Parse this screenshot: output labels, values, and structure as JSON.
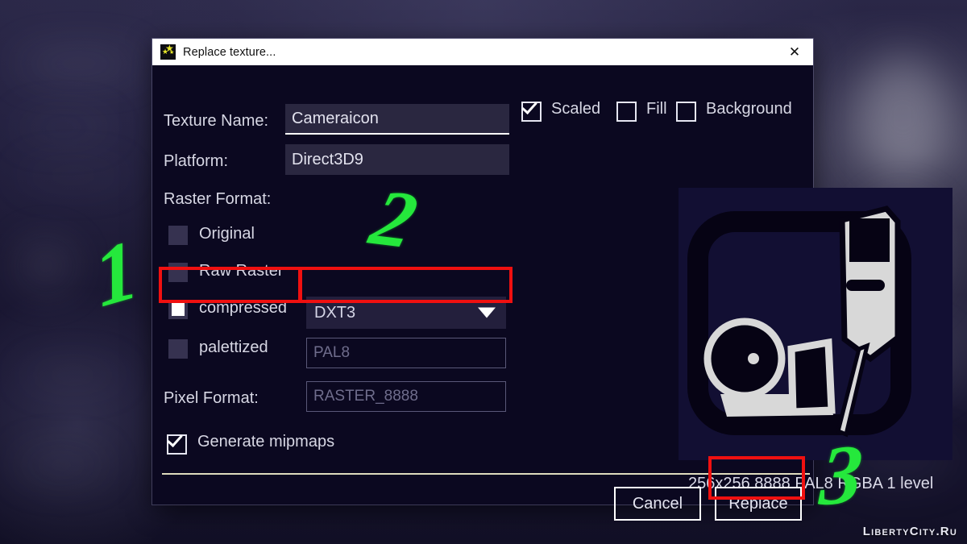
{
  "window": {
    "title": "Replace texture...",
    "icon": "stars-icon",
    "close_label": "✕"
  },
  "form": {
    "texture_name_label": "Texture Name:",
    "texture_name_value": "Cameraicon",
    "platform_label": "Platform:",
    "platform_value": "Direct3D9",
    "raster_format_label": "Raster Format:",
    "options": [
      {
        "label": "Original",
        "checked": false
      },
      {
        "label": "Raw Raster",
        "checked": false
      },
      {
        "label": "compressed",
        "checked": true
      },
      {
        "label": "palettized",
        "checked": false
      }
    ],
    "compression_value": "DXT3",
    "palette_value": "PAL8",
    "pixel_format_label": "Pixel Format:",
    "pixel_format_value": "RASTER_8888",
    "generate_mipmaps_label": "Generate mipmaps",
    "generate_mipmaps_checked": true
  },
  "preview": {
    "toggles": [
      {
        "label": "Scaled",
        "checked": true
      },
      {
        "label": "Fill",
        "checked": false
      },
      {
        "label": "Background",
        "checked": false
      }
    ],
    "info": "256x256 8888 PAL8 RGBA 1 level",
    "image_name": "camera-icon-texture"
  },
  "footer": {
    "cancel_label": "Cancel",
    "replace_label": "Replace"
  },
  "annotations": {
    "step1": "1",
    "step2": "2",
    "step3": "3",
    "marker_color": "#25e83c",
    "highlight_color": "#f01010"
  },
  "watermark": "LibertyCity.Ru"
}
